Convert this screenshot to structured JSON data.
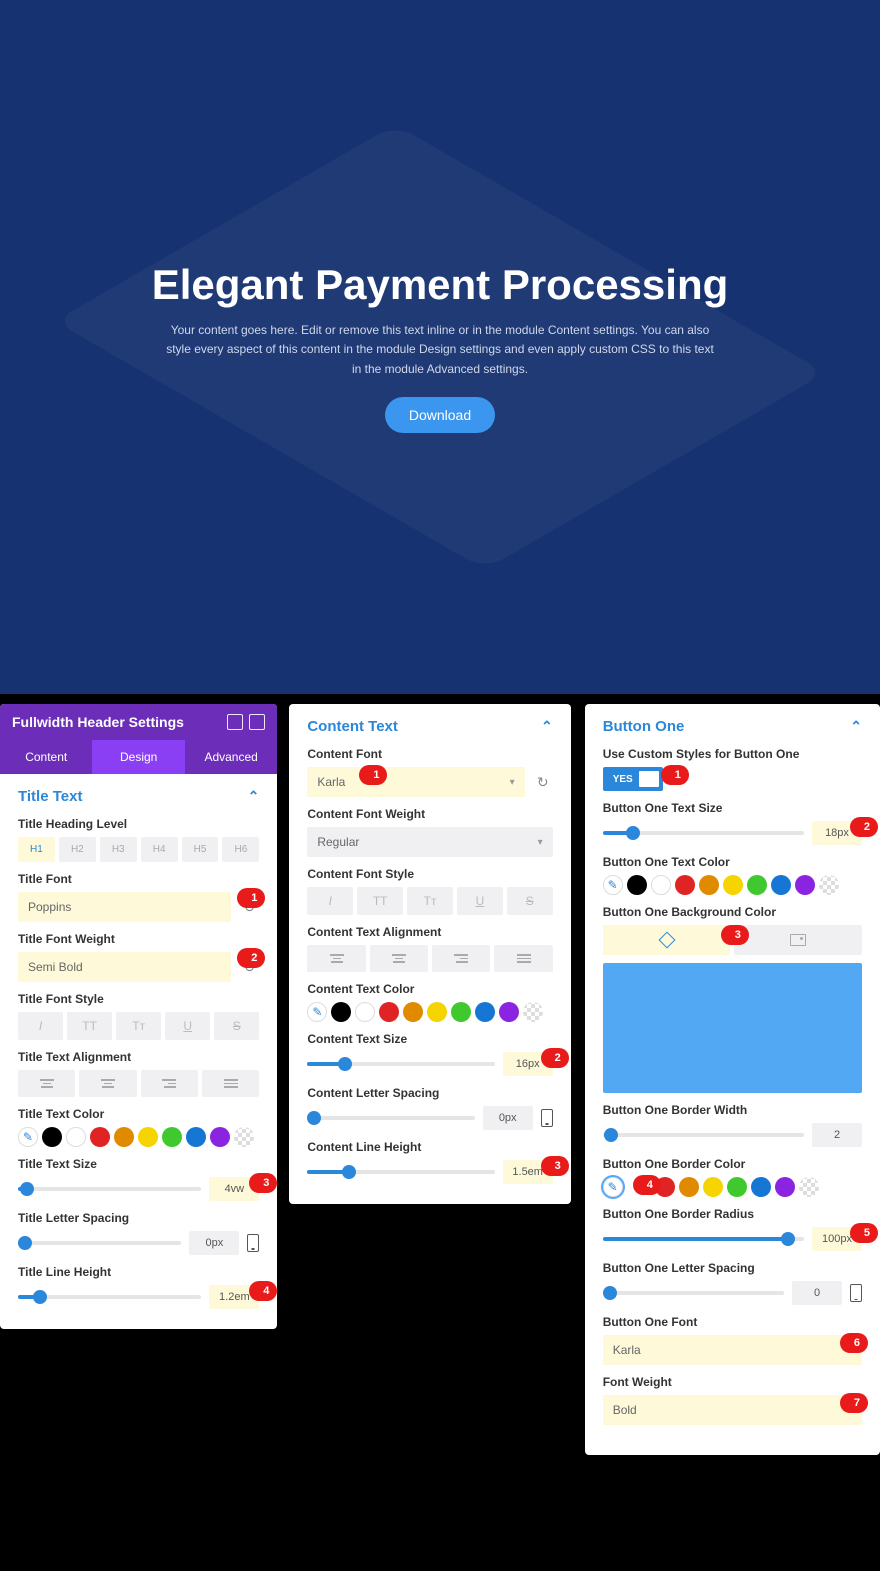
{
  "hero": {
    "title": "Elegant Payment Processing",
    "description": "Your content goes here. Edit or remove this text inline or in the module Content settings. You can also style every aspect of this content in the module Design settings and even apply custom CSS to this text in the module Advanced settings.",
    "button_label": "Download"
  },
  "panel1": {
    "title": "Fullwidth Header Settings",
    "tabs": {
      "content": "Content",
      "design": "Design",
      "advanced": "Advanced"
    },
    "section": "Title Text",
    "heading_level_label": "Title Heading Level",
    "heading_levels": [
      "H1",
      "H2",
      "H3",
      "H4",
      "H5",
      "H6"
    ],
    "font_label": "Title Font",
    "font_value": "Poppins",
    "weight_label": "Title Font Weight",
    "weight_value": "Semi Bold",
    "style_label": "Title Font Style",
    "align_label": "Title Text Alignment",
    "color_label": "Title Text Color",
    "size_label": "Title Text Size",
    "size_value": "4vw",
    "spacing_label": "Title Letter Spacing",
    "spacing_value": "0px",
    "lineheight_label": "Title Line Height",
    "lineheight_value": "1.2em",
    "markers": {
      "m1": "1",
      "m2": "2",
      "m3": "3",
      "m4": "4"
    }
  },
  "panel2": {
    "section": "Content Text",
    "font_label": "Content Font",
    "font_value": "Karla",
    "weight_label": "Content Font Weight",
    "weight_value": "Regular",
    "style_label": "Content Font Style",
    "align_label": "Content Text Alignment",
    "color_label": "Content Text Color",
    "size_label": "Content Text Size",
    "size_value": "16px",
    "spacing_label": "Content Letter Spacing",
    "spacing_value": "0px",
    "lineheight_label": "Content Line Height",
    "lineheight_value": "1.5em",
    "markers": {
      "m1": "1",
      "m2": "2",
      "m3": "3"
    }
  },
  "panel3": {
    "section": "Button One",
    "custom_label": "Use Custom Styles for Button One",
    "toggle_yes": "YES",
    "textsize_label": "Button One Text Size",
    "textsize_value": "18px",
    "textcolor_label": "Button One Text Color",
    "bgcolor_label": "Button One Background Color",
    "borderw_label": "Button One Border Width",
    "borderw_value": "2",
    "borderc_label": "Button One Border Color",
    "radius_label": "Button One Border Radius",
    "radius_value": "100px",
    "letterspace_label": "Button One Letter Spacing",
    "letterspace_value": "0",
    "font_label": "Button One Font",
    "font_value": "Karla",
    "weight_label": "Font Weight",
    "weight_value": "Bold",
    "markers": {
      "m1": "1",
      "m2": "2",
      "m3": "3",
      "m4": "4",
      "m5": "5",
      "m6": "6",
      "m7": "7"
    },
    "swatch_colors": [
      "#000000",
      "#ffffff",
      "#e02424",
      "#e08a00",
      "#f5d400",
      "#3fc92f",
      "#1676d4",
      "#8a24e0"
    ]
  }
}
